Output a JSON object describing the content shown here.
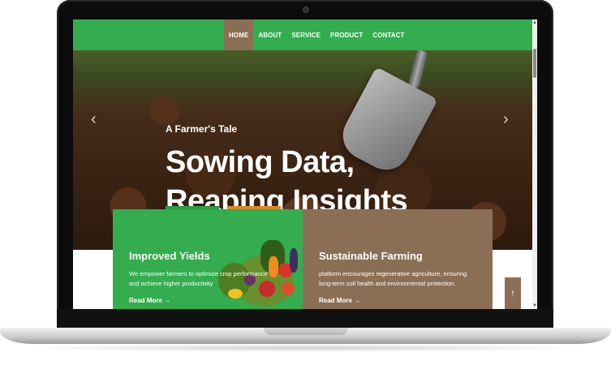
{
  "nav": {
    "items": [
      {
        "label": "HOME",
        "active": true
      },
      {
        "label": "ABOUT",
        "active": false
      },
      {
        "label": "SERVICE",
        "active": false
      },
      {
        "label": "PRODUCT",
        "active": false
      },
      {
        "label": "CONTACT",
        "active": false
      }
    ]
  },
  "hero": {
    "eyebrow": "A Farmer's Tale",
    "title": "Sowing Data, Reaping Insights",
    "prev_icon": "chevron-left-icon",
    "next_icon": "chevron-right-icon"
  },
  "cards": [
    {
      "title": "Improved Yields",
      "text": "We empower farmers to optimize crop performance and achieve higher productivity",
      "link": "Read More →",
      "color": "#33ad4e"
    },
    {
      "title": "Sustainable Farming",
      "text": "platform encourages regenerative agriculture, ensuring long-term soil health and environmental protection.",
      "link": "Read More →",
      "color": "#8b6f55"
    }
  ],
  "scroll_top": {
    "icon": "arrow-up-icon",
    "glyph": "↑"
  },
  "colors": {
    "brand_green": "#33ad4e",
    "brand_brown": "#8b6f55",
    "accent_orange": "#e0862a"
  }
}
